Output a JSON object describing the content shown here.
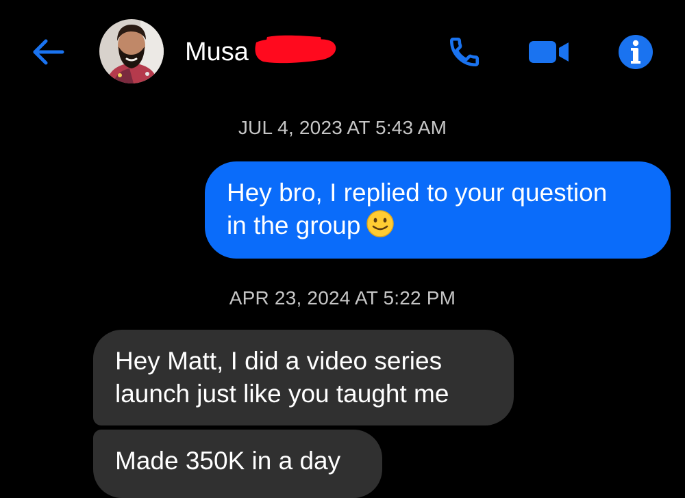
{
  "header": {
    "contact_name": "Musa",
    "avatar_icon": "profile-photo",
    "back_icon": "arrow-left-icon",
    "call_icon": "phone-icon",
    "video_icon": "video-camera-icon",
    "info_icon": "info-icon"
  },
  "colors": {
    "accent": "#0a6cfa",
    "background": "#000000",
    "incoming_bubble": "#303030",
    "redaction": "#ff0a1e"
  },
  "conversation": {
    "timestamp_1": "JUL 4, 2023 AT 5:43 AM",
    "message_1": {
      "line_1": "Hey bro, I replied to your question",
      "line_2": "in the group"
    },
    "timestamp_2": "APR 23, 2024 AT 5:22 PM",
    "message_2": {
      "line_1": "Hey Matt, I did a video series",
      "line_2": "launch just like you taught me"
    },
    "message_3": {
      "line_1": "Made 350K in a day"
    }
  }
}
